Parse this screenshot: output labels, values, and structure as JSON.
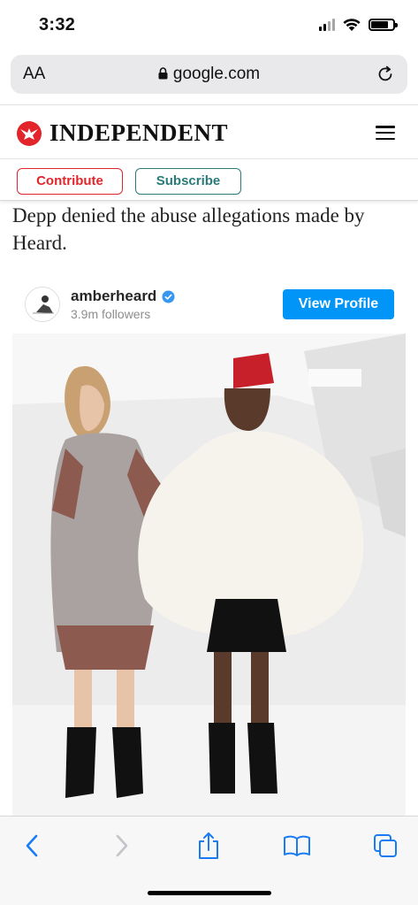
{
  "status_bar": {
    "time": "3:32",
    "icons": [
      "signal-icon",
      "wifi-icon",
      "battery-icon"
    ]
  },
  "browser": {
    "text_size_label": "AA",
    "domain": "google.com",
    "icons": [
      "lock-icon",
      "reload-icon"
    ]
  },
  "site": {
    "logo_text": "INDEPENDENT",
    "logo_icon": "eagle-logo-icon",
    "menu_icon": "hamburger-menu-icon",
    "brand_red": "#e2252b",
    "brand_teal": "#2a7a78"
  },
  "cta": {
    "contribute_label": "Contribute",
    "subscribe_label": "Subscribe"
  },
  "article": {
    "paragraph": "Depp denied the abuse allegations made by Heard."
  },
  "instagram_embed": {
    "username": "amberheard",
    "followers": "3.9m followers",
    "view_profile_label": "View Profile",
    "verified_icon": "verified-badge-icon",
    "button_color": "#0095f6"
  },
  "toolbar": {
    "icons": [
      "back-icon",
      "forward-icon",
      "share-icon",
      "bookmarks-icon",
      "tabs-icon"
    ],
    "accent": "#1a7cf5"
  }
}
